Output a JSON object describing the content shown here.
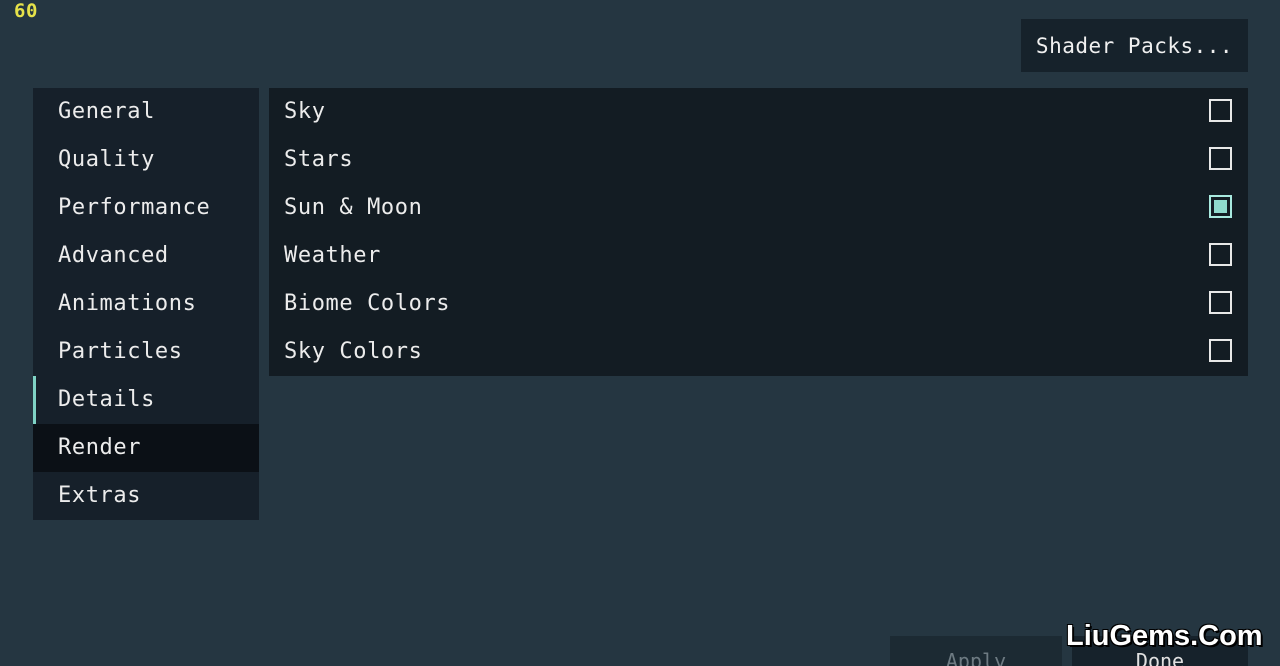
{
  "fps_counter": "60",
  "header": {
    "shader_packs_label": "Shader Packs..."
  },
  "sidebar": {
    "items": [
      {
        "label": "General"
      },
      {
        "label": "Quality"
      },
      {
        "label": "Performance"
      },
      {
        "label": "Advanced"
      },
      {
        "label": "Animations"
      },
      {
        "label": "Particles"
      },
      {
        "label": "Details",
        "state": "active"
      },
      {
        "label": "Render",
        "state": "selected"
      },
      {
        "label": "Extras"
      }
    ]
  },
  "options": [
    {
      "label": "Sky",
      "checked": false
    },
    {
      "label": "Stars",
      "checked": false
    },
    {
      "label": "Sun & Moon",
      "checked": true
    },
    {
      "label": "Weather",
      "checked": false
    },
    {
      "label": "Biome Colors",
      "checked": false
    },
    {
      "label": "Sky Colors",
      "checked": false
    }
  ],
  "footer": {
    "apply_label": "Apply",
    "done_label": "Done"
  },
  "watermark": "LiuGems.Com",
  "colors": {
    "background": "#253641",
    "accent": "#7fd3c5",
    "fps_text": "#e6e24a"
  }
}
